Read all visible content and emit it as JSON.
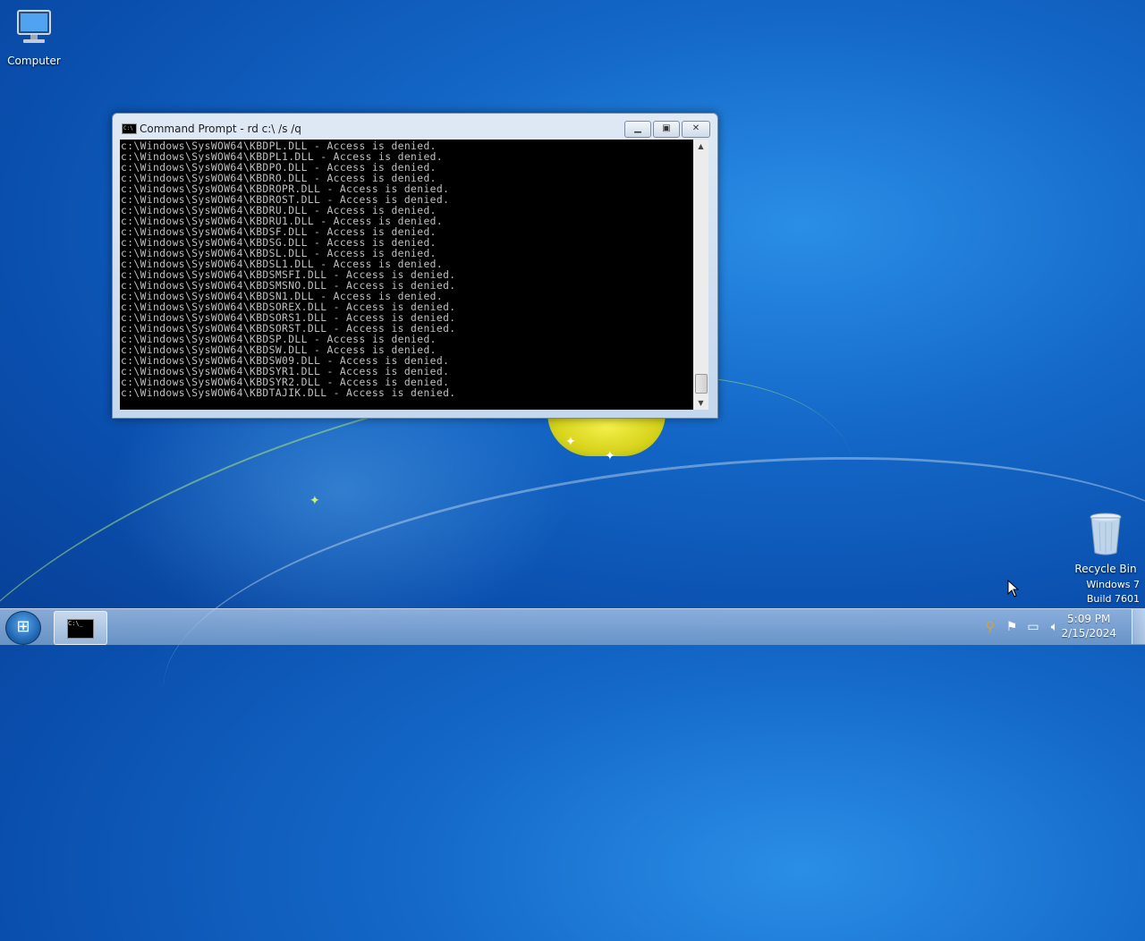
{
  "desktop": {
    "icons": [
      {
        "label": "Computer",
        "icon": "computer-icon"
      },
      {
        "label": "Recycle Bin",
        "icon": "recycle-bin-icon"
      }
    ],
    "watermark": {
      "line1": "Windows 7",
      "line2": "Build 7601"
    }
  },
  "cmd_window": {
    "title": "Command Prompt - rd  c:\\ /s /q",
    "buttons": {
      "minimize": "minimize-icon",
      "maximize": "maximize-icon",
      "close": "close-icon"
    },
    "lines": [
      "c:\\Windows\\SysWOW64\\KBDPL.DLL - Access is denied.",
      "c:\\Windows\\SysWOW64\\KBDPL1.DLL - Access is denied.",
      "c:\\Windows\\SysWOW64\\KBDPO.DLL - Access is denied.",
      "c:\\Windows\\SysWOW64\\KBDRO.DLL - Access is denied.",
      "c:\\Windows\\SysWOW64\\KBDROPR.DLL - Access is denied.",
      "c:\\Windows\\SysWOW64\\KBDROST.DLL - Access is denied.",
      "c:\\Windows\\SysWOW64\\KBDRU.DLL - Access is denied.",
      "c:\\Windows\\SysWOW64\\KBDRU1.DLL - Access is denied.",
      "c:\\Windows\\SysWOW64\\KBDSF.DLL - Access is denied.",
      "c:\\Windows\\SysWOW64\\KBDSG.DLL - Access is denied.",
      "c:\\Windows\\SysWOW64\\KBDSL.DLL - Access is denied.",
      "c:\\Windows\\SysWOW64\\KBDSL1.DLL - Access is denied.",
      "c:\\Windows\\SysWOW64\\KBDSMSFI.DLL - Access is denied.",
      "c:\\Windows\\SysWOW64\\KBDSMSNO.DLL - Access is denied.",
      "c:\\Windows\\SysWOW64\\KBDSN1.DLL - Access is denied.",
      "c:\\Windows\\SysWOW64\\KBDSOREX.DLL - Access is denied.",
      "c:\\Windows\\SysWOW64\\KBDSORS1.DLL - Access is denied.",
      "c:\\Windows\\SysWOW64\\KBDSORST.DLL - Access is denied.",
      "c:\\Windows\\SysWOW64\\KBDSP.DLL - Access is denied.",
      "c:\\Windows\\SysWOW64\\KBDSW.DLL - Access is denied.",
      "c:\\Windows\\SysWOW64\\KBDSW09.DLL - Access is denied.",
      "c:\\Windows\\SysWOW64\\KBDSYR1.DLL - Access is denied.",
      "c:\\Windows\\SysWOW64\\KBDSYR2.DLL - Access is denied.",
      "c:\\Windows\\SysWOW64\\KBDTAJIK.DLL - Access is denied."
    ]
  },
  "taskbar": {
    "start_icon": "windows-start-icon",
    "pinned": [
      {
        "icon": "command-prompt-icon"
      }
    ],
    "tray": [
      "search-icon",
      "action-center-flag-icon",
      "network-icon",
      "volume-muted-icon"
    ],
    "clock": {
      "time": "5:09 PM",
      "date": "2/15/2024"
    }
  },
  "colors": {
    "cmd_text": "#c0c0c0",
    "cmd_bg": "#000000",
    "taskbar": "#9fbadb"
  }
}
